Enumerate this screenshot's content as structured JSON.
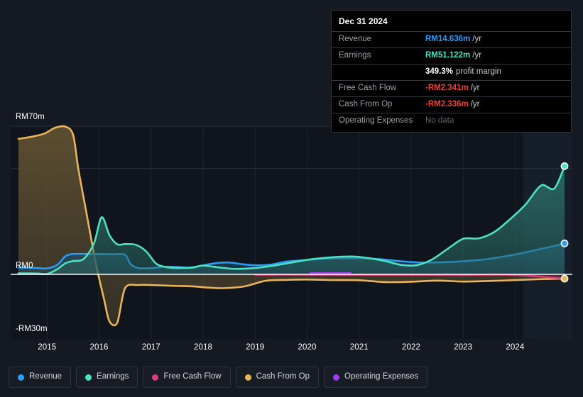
{
  "theme": {
    "background": "#151a22",
    "plot_background": "#10151d",
    "zero_line": "#ffffff",
    "grid": "#2b303a",
    "forecast_band": "#16202c"
  },
  "tooltip": {
    "date": "Dec 31 2024",
    "rows": [
      {
        "label": "Revenue",
        "value": "RM14.636m",
        "unit": "/yr",
        "color_key": "revenue",
        "suffix": ""
      },
      {
        "label": "Earnings",
        "value": "RM51.122m",
        "unit": "/yr",
        "color_key": "earnings",
        "suffix": ""
      },
      {
        "label": "",
        "value": "349.3%",
        "unit": "",
        "color_key": "plain",
        "suffix": "profit margin"
      },
      {
        "label": "Free Cash Flow",
        "value": "-RM2.341m",
        "unit": "/yr",
        "color_key": "negative",
        "suffix": ""
      },
      {
        "label": "Cash From Op",
        "value": "-RM2.336m",
        "unit": "/yr",
        "color_key": "negative",
        "suffix": ""
      },
      {
        "label": "Operating Expenses",
        "value": "No data",
        "unit": "",
        "color_key": "nodata",
        "suffix": ""
      }
    ]
  },
  "legend": {
    "items": [
      {
        "label": "Revenue",
        "color": "#2a9df4"
      },
      {
        "label": "Earnings",
        "color": "#4fe0c0"
      },
      {
        "label": "Free Cash Flow",
        "color": "#d9407a"
      },
      {
        "label": "Cash From Op",
        "color": "#eab459"
      },
      {
        "label": "Operating Expenses",
        "color": "#a03cf0"
      }
    ]
  },
  "chart_data": {
    "type": "area",
    "title": "",
    "xlabel": "",
    "ylabel": "",
    "currency": "RM",
    "unit": "m",
    "ylim": [
      -30,
      70
    ],
    "y_ticks": [
      {
        "label": "RM70m",
        "value": 70
      },
      {
        "label": "RM0",
        "value": 0
      },
      {
        "label": "-RM30m",
        "value": -30
      }
    ],
    "gridlines": [
      70,
      50,
      0,
      -30
    ],
    "x_ticks": [
      "2015",
      "2016",
      "2017",
      "2018",
      "2019",
      "2020",
      "2021",
      "2022",
      "2023",
      "2024"
    ],
    "xlim": [
      2014.3,
      2025.1
    ],
    "legend_position": "bottom",
    "grid": true,
    "forecast_band": {
      "start": 2024.15,
      "end": 2025.1
    },
    "series": [
      {
        "name": "Revenue",
        "color": "#2a9df4",
        "fill": "#1d4a68",
        "end_marker": true,
        "x": [
          2014.45,
          2014.8,
          2015.0,
          2015.2,
          2015.35,
          2015.5,
          2015.75,
          2016.0,
          2016.25,
          2016.5,
          2016.6,
          2016.75,
          2017.0,
          2017.25,
          2017.5,
          2017.75,
          2018.0,
          2018.25,
          2018.5,
          2018.75,
          2019.0,
          2019.3,
          2019.6,
          2020.0,
          2020.4,
          2020.8,
          2021.0,
          2021.4,
          2021.8,
          2022.2,
          2022.6,
          2023.0,
          2023.4,
          2023.8,
          2024.2,
          2024.6,
          2024.95
        ],
        "values": [
          3.2,
          3.0,
          2.8,
          4.5,
          8.5,
          9.6,
          9.6,
          9.6,
          9.5,
          9.3,
          5.0,
          3.0,
          2.9,
          3.6,
          3.5,
          3.2,
          4.3,
          5.3,
          5.6,
          4.8,
          4.3,
          4.6,
          6.0,
          6.8,
          7.4,
          7.6,
          7.6,
          7.2,
          6.2,
          5.6,
          5.7,
          6.2,
          7.0,
          8.5,
          10.4,
          12.6,
          14.636
        ]
      },
      {
        "name": "Earnings",
        "color": "#4fe0c0",
        "fill": "#2a6a63",
        "end_marker": true,
        "x": [
          2014.45,
          2014.8,
          2015.0,
          2015.2,
          2015.35,
          2015.5,
          2015.7,
          2015.9,
          2016.05,
          2016.2,
          2016.35,
          2016.5,
          2016.7,
          2016.9,
          2017.1,
          2017.3,
          2017.5,
          2017.8,
          2018.0,
          2018.3,
          2018.6,
          2019.0,
          2019.4,
          2019.8,
          2020.1,
          2020.5,
          2020.9,
          2021.2,
          2021.5,
          2021.8,
          2022.1,
          2022.4,
          2022.7,
          2023.0,
          2023.3,
          2023.6,
          2023.9,
          2024.2,
          2024.5,
          2024.75,
          2024.95
        ],
        "values": [
          0.5,
          0.4,
          0.2,
          2.5,
          5.2,
          6.3,
          7.2,
          14.5,
          27.0,
          18.5,
          14.2,
          14.3,
          14.0,
          11.0,
          5.0,
          3.4,
          3.0,
          3.2,
          4.1,
          3.3,
          2.6,
          3.0,
          4.3,
          6.0,
          7.2,
          8.1,
          8.4,
          7.6,
          6.3,
          4.5,
          4.3,
          7.0,
          12.0,
          16.8,
          17.0,
          20.0,
          26.0,
          33.0,
          42.0,
          40.5,
          51.122
        ]
      },
      {
        "name": "Free Cash Flow",
        "color": "#d9407a",
        "fill": "#5a2230",
        "end_marker": false,
        "starts_at": 2019.0,
        "x": [
          2019.0,
          2020.0,
          2021.0,
          2022.0,
          2023.0,
          2024.0,
          2024.95
        ],
        "values": [
          -0.2,
          -0.2,
          -0.25,
          -0.25,
          -0.3,
          -0.3,
          -2.341
        ]
      },
      {
        "name": "Cash From Op",
        "color": "#eab459",
        "fill": "#5f5031",
        "end_marker": true,
        "x": [
          2014.45,
          2014.7,
          2014.95,
          2015.15,
          2015.35,
          2015.5,
          2015.6,
          2015.75,
          2015.9,
          2016.0,
          2016.1,
          2016.2,
          2016.35,
          2016.5,
          2016.75,
          2017.0,
          2017.4,
          2017.8,
          2018.1,
          2018.4,
          2018.8,
          2019.2,
          2019.6,
          2020.0,
          2020.5,
          2021.0,
          2021.5,
          2022.0,
          2022.5,
          2023.0,
          2023.5,
          2024.0,
          2024.5,
          2024.95
        ],
        "values": [
          64.0,
          65.0,
          66.5,
          69.2,
          69.8,
          66.0,
          50.0,
          30.0,
          10.0,
          -2.0,
          -14.0,
          -25.5,
          -26.2,
          -7.5,
          -5.8,
          -5.8,
          -6.2,
          -6.5,
          -7.2,
          -7.5,
          -6.5,
          -3.5,
          -3.0,
          -2.8,
          -3.1,
          -3.2,
          -4.2,
          -4.0,
          -3.4,
          -3.9,
          -3.6,
          -3.1,
          -2.6,
          -2.336
        ]
      },
      {
        "name": "Operating Expenses",
        "color": "#a03cf0",
        "fill": "#a03cf0",
        "end_marker": false,
        "segment_only": true,
        "x": [
          2020.05,
          2020.85
        ],
        "values": [
          0.0,
          0.0
        ]
      }
    ]
  }
}
